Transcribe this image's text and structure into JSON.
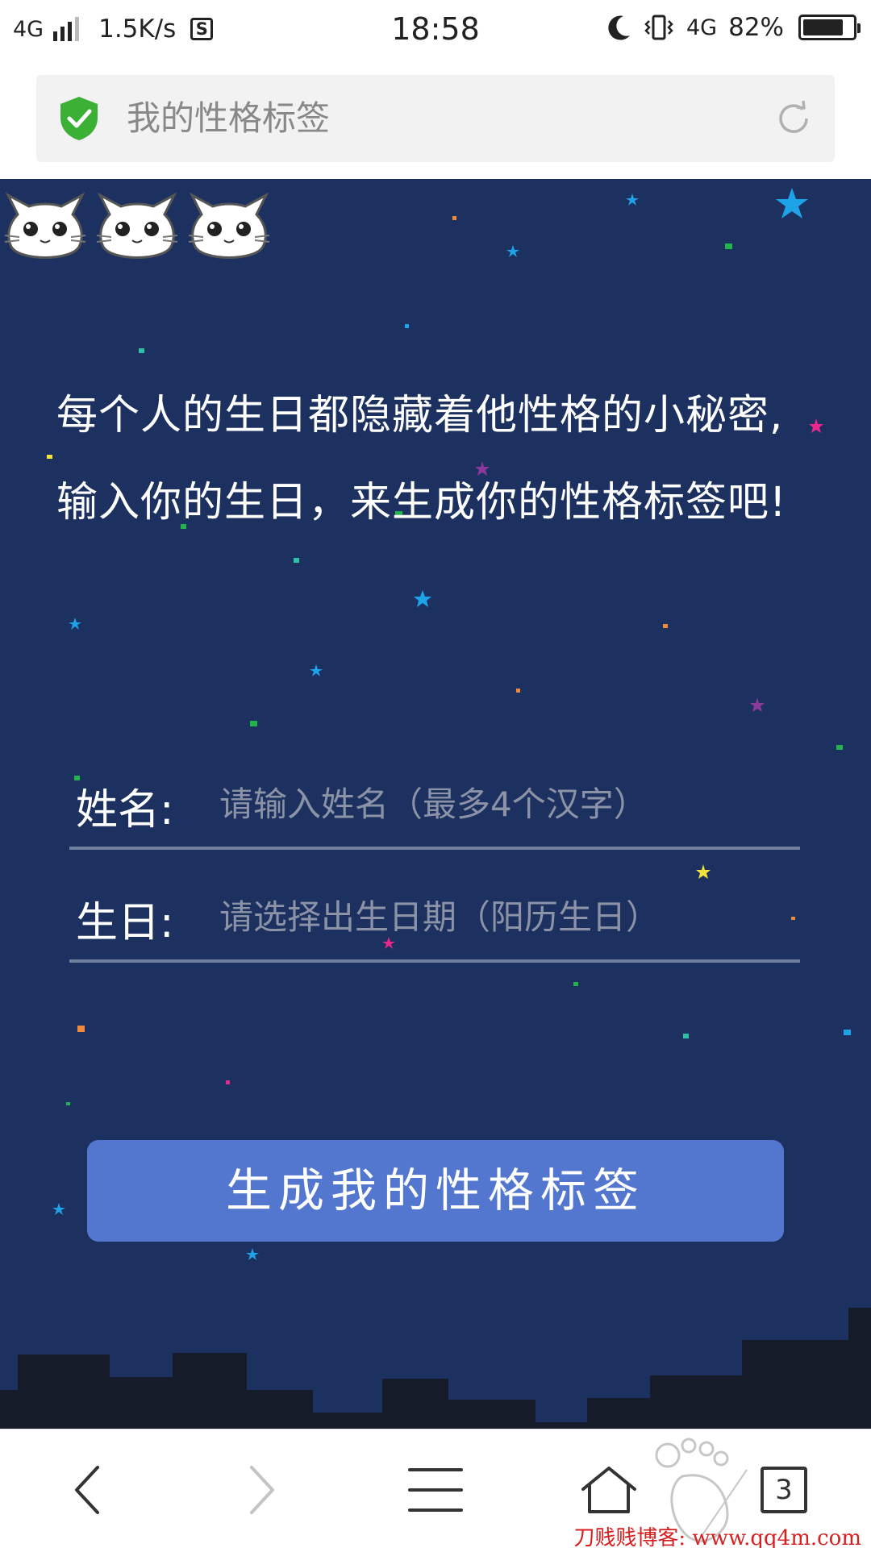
{
  "status_bar": {
    "network": "4G",
    "speed": "1.5K/s",
    "s_icon": "S",
    "time": "18:58",
    "network_right": "4G",
    "battery_percent": "82%",
    "battery_level": 0.82,
    "icons": [
      "signal-icon",
      "s-app-icon",
      "moon-icon",
      "vibrate-icon",
      "battery-icon"
    ]
  },
  "browser": {
    "page_title": "我的性格标签",
    "security_icon": "green-shield-check-icon",
    "reload_icon": "reload-icon",
    "tab_count": "3",
    "toolbar_icons": [
      "back-icon",
      "forward-icon",
      "menu-icon",
      "home-icon",
      "tabs-icon"
    ]
  },
  "intro": {
    "line1": "每个人的生日都隐藏着他性格的小秘密,",
    "line2": "输入你的生日，来生成你的性格标签吧!"
  },
  "form": {
    "name_label": "姓名:",
    "name_placeholder": "请输入姓名（最多4个汉字）",
    "birthday_label": "生日:",
    "birthday_placeholder": "请选择出生日期（阳历生日）"
  },
  "button": {
    "generate_label": "生成我的性格标签"
  },
  "watermark": {
    "text": "刀贱贱博客: www.qq4m.com"
  },
  "colors": {
    "page_background": "#1d3160",
    "button": "#5377cf",
    "skyline": "#161b2a",
    "shield": "#3cb034",
    "watermark": "#d81e1e"
  }
}
